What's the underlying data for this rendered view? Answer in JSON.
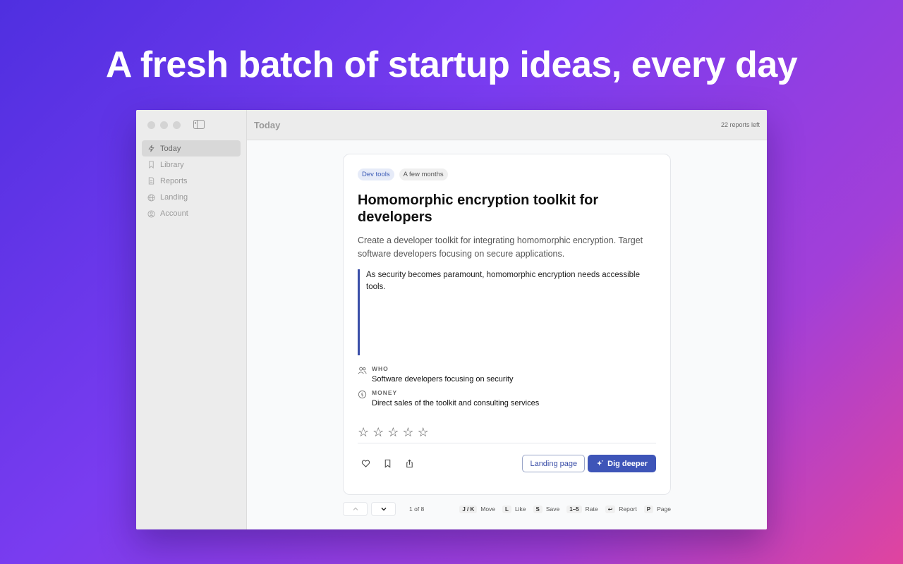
{
  "headline": "A fresh batch of startup ideas, every day",
  "toolbar": {
    "title": "Today",
    "reports_left": "22 reports left"
  },
  "sidebar": {
    "items": [
      {
        "label": "Today",
        "icon": "bolt-icon"
      },
      {
        "label": "Library",
        "icon": "bookmark-icon"
      },
      {
        "label": "Reports",
        "icon": "document-icon"
      },
      {
        "label": "Landing",
        "icon": "globe-icon"
      },
      {
        "label": "Account",
        "icon": "user-circle-icon"
      }
    ]
  },
  "card": {
    "tags": [
      "Dev tools",
      "A few months"
    ],
    "title": "Homomorphic encryption toolkit for developers",
    "description": "Create a developer toolkit for integrating homomorphic encryption. Target software developers focusing on secure applications.",
    "quote": "As security becomes paramount, homomorphic encryption needs accessible tools.",
    "who_label": "WHO",
    "who_value": "Software developers focusing on security",
    "money_label": "MONEY",
    "money_value": "Direct sales of the toolkit and consulting services",
    "star_glyph": "☆",
    "landing_label": "Landing page",
    "dig_label": "Dig deeper"
  },
  "pager": {
    "count": "1 of 8",
    "shortcuts": [
      {
        "key": "J / K",
        "label": "Move"
      },
      {
        "key": "L",
        "label": "Like"
      },
      {
        "key": "S",
        "label": "Save"
      },
      {
        "key": "1–5",
        "label": "Rate"
      },
      {
        "key": "↩",
        "label": "Report"
      },
      {
        "key": "P",
        "label": "Page"
      }
    ]
  },
  "colors": {
    "accent": "#3e55b8",
    "quote_border": "#3b4fa8"
  }
}
